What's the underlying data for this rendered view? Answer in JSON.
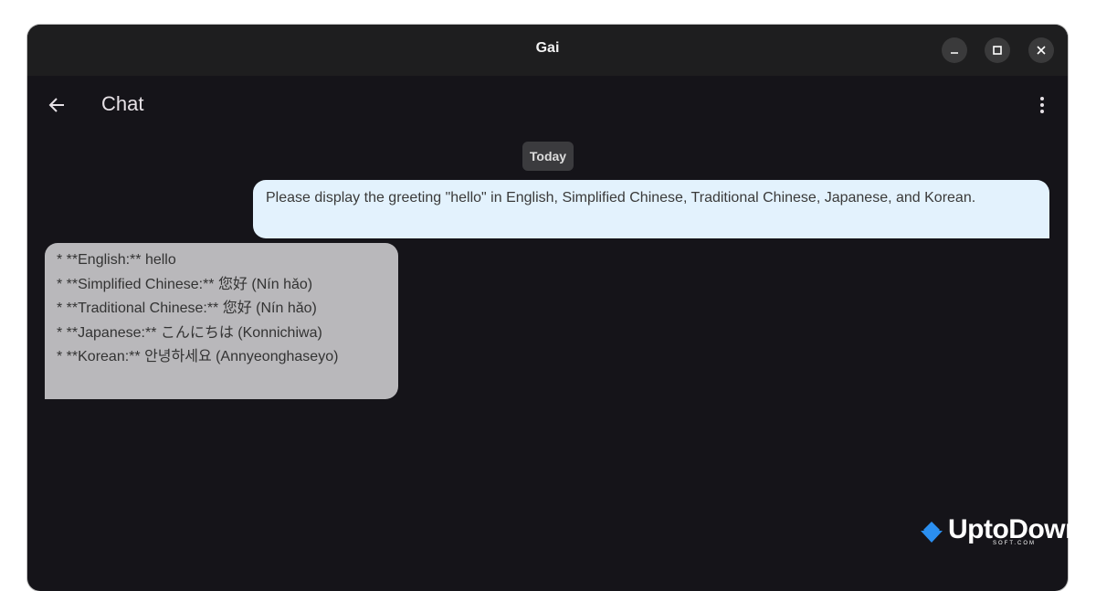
{
  "window": {
    "title": "Gai",
    "controls": {
      "minimize_icon": "minimize-icon",
      "maximize_icon": "maximize-icon",
      "close_icon": "close-icon"
    }
  },
  "appbar": {
    "title": "Chat",
    "back_icon": "arrow-back-icon",
    "menu_icon": "more-vert-icon"
  },
  "chat": {
    "date_label": "Today",
    "messages": [
      {
        "role": "user",
        "text": "Please display the greeting \"hello\" in English, Simplified Chinese, Traditional Chinese, Japanese, and Korean."
      },
      {
        "role": "assistant",
        "lines": [
          "* **English:** hello",
          "* **Simplified Chinese:** 您好 (Nín hǎo)",
          "* **Traditional Chinese:** 您好 (Nín hǎo)",
          "* **Japanese:** こんにちは (Konnichiwa)",
          "* **Korean:** 안녕하세요 (Annyeonghaseyo)"
        ]
      }
    ]
  },
  "watermark": {
    "text": "UptoDown",
    "subtext": "SOFT.COM"
  },
  "colors": {
    "window_bg": "#151419",
    "titlebar_bg": "#1e1e1f",
    "user_bubble": "#e3f2fd",
    "assistant_bubble": "#b9b8bb",
    "date_chip": "#3b3b3e",
    "watermark_logo": "#2b8ff0"
  }
}
